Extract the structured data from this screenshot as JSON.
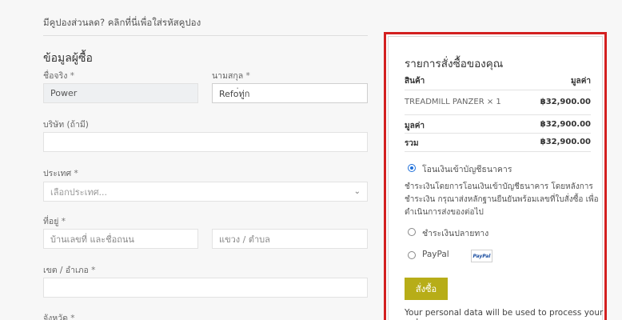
{
  "coupon": {
    "text": "มีคูปองส่วนลด? คลิกที่นี่เพื่อใส่รหัสคูปอง"
  },
  "billing": {
    "heading": "ข้อมูลผู้ซื้อ",
    "first_name": {
      "label": "ชื่อจริง",
      "required": "*",
      "value": "Power"
    },
    "last_name": {
      "label": "นามสกุล",
      "required": "*",
      "value": "Refo่ทู่ก"
    },
    "company": {
      "label": "บริษัท (ถ้ามี)",
      "value": ""
    },
    "country": {
      "label": "ประเทศ",
      "required": "*",
      "placeholder": "เลือกประเทศ..."
    },
    "address": {
      "label": "ที่อยู่",
      "required": "*",
      "placeholder1": "บ้านเลขที่ และชื่อถนน",
      "placeholder2": "แขวง / ตำบล"
    },
    "district": {
      "label": "เขต / อำเภอ",
      "required": "*",
      "value": ""
    },
    "province": {
      "label": "จังหวัด",
      "required": "*"
    }
  },
  "order": {
    "title": "รายการสั่งซื้อของคุณ",
    "col_product": "สินค้า",
    "col_total": "มูลค่า",
    "item_name": "TREADMILL PANZER",
    "item_qty": "× 1",
    "item_price": "฿32,900.00",
    "subtotal_label": "มูลค่า",
    "subtotal_value": "฿32,900.00",
    "total_label": "รวม",
    "total_value": "฿32,900.00"
  },
  "payment": {
    "bank_transfer": {
      "label": "โอนเงินเข้าบัญชีธนาคาร",
      "description": "ชำระเงินโดยการโอนเงินเข้าบัญชีธนาคาร โดยหลังการชำระเงิน กรุณาส่งหลักฐานยืนยันพร้อมเลขที่ใบสั่งซื้อ เพื่อดำเนินการส่งของต่อไป"
    },
    "cod": {
      "label": "ชำระเงินปลายทาง"
    },
    "paypal": {
      "label": "PayPal",
      "badge": "PayPal"
    }
  },
  "place_order": {
    "label": "สั่งซื้อ"
  },
  "privacy": {
    "text": "Your personal data will be used to process your order,"
  },
  "colors": {
    "accent": "#b7ad18",
    "highlight_border": "#d32020",
    "radio": "#1e6fd9"
  }
}
